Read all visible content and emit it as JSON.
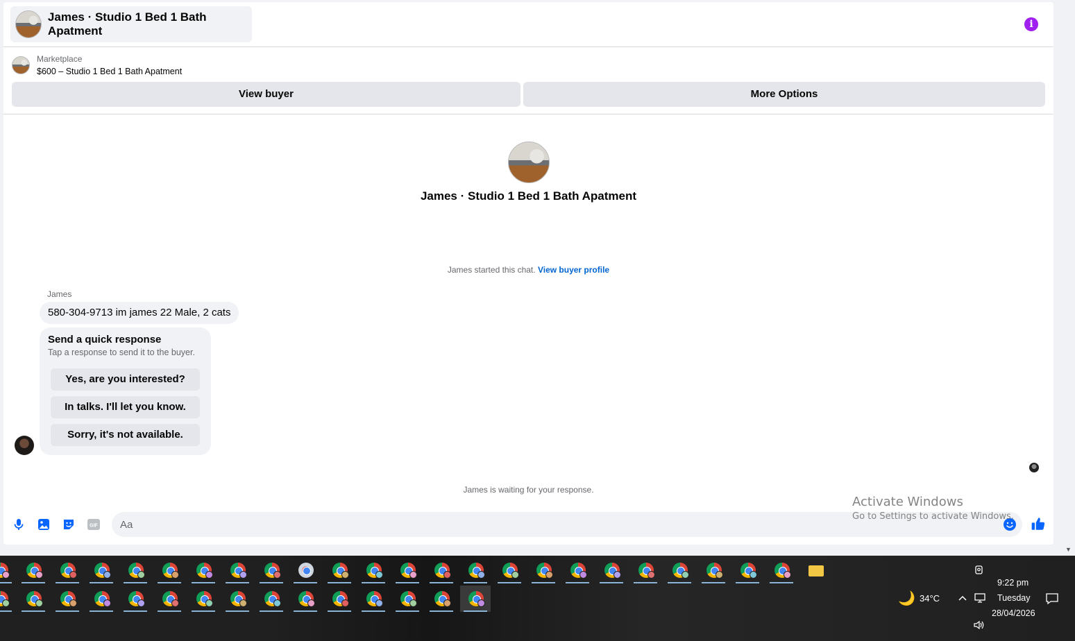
{
  "header": {
    "title": "James · Studio 1 Bed 1 Bath Apatment",
    "info_icon": "info-icon",
    "info_color": "#a020f0"
  },
  "listing": {
    "source": "Marketplace",
    "item": "$600 – Studio 1 Bed 1 Bath Apatment",
    "view_buyer_label": "View buyer",
    "more_options_label": "More Options"
  },
  "profile": {
    "name": "James · Studio 1 Bed 1 Bath Apatment"
  },
  "conversation": {
    "started_text": "James started this chat.",
    "view_profile_link": "View buyer profile",
    "sender_name": "James",
    "message": "580-304-9713 im james 22 Male, 2 cats",
    "quick_title": "Send a quick response",
    "quick_subtitle": "Tap a response to send it to the buyer.",
    "quick_responses": [
      "Yes, are you interested?",
      "In talks. I'll let you know.",
      "Sorry, it's not available."
    ],
    "waiting_text": "James is waiting for your response."
  },
  "composer": {
    "placeholder": "Aa",
    "icons": [
      "microphone-icon",
      "photo-icon",
      "sticker-icon",
      "gif-icon",
      "emoji-icon",
      "thumbs-up-icon"
    ],
    "gif_label": "GIF",
    "accent_color": "#0866ff"
  },
  "watermark": {
    "line1": "Activate Windows",
    "line2": "Go to Settings to activate Windows."
  },
  "taskbar": {
    "weather_temp": "34°C",
    "weather_icon": "moon-icon",
    "time": "9:22 pm",
    "day": "Tuesday",
    "date": "28/04/2026"
  }
}
